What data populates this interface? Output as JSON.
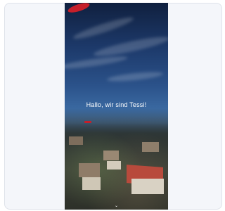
{
  "hero": {
    "title": "Hallo, wir sind Tessi!",
    "subtitle": "",
    "cta_label": ""
  },
  "nav": {
    "items": [
      "",
      "",
      "",
      "",
      "",
      "",
      ""
    ]
  },
  "colors": {
    "brand_red": "#c61f2a",
    "sky_dark": "#10203f",
    "sky_light": "#4c79ad"
  },
  "icons": {
    "logo": "brand-logo",
    "scroll": "chevron-down-icon"
  },
  "scroll_hint": "⌄"
}
